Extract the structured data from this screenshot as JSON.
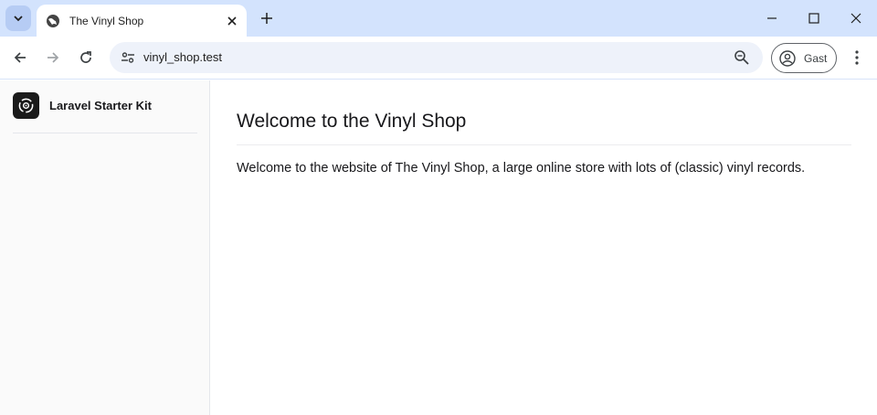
{
  "browser": {
    "tab": {
      "title": "The Vinyl Shop"
    },
    "address": {
      "url": "vinyl_shop.test"
    },
    "profile": {
      "name": "Gast"
    }
  },
  "sidebar": {
    "brand": "Laravel Starter Kit"
  },
  "main": {
    "heading": "Welcome to the Vinyl Shop",
    "text": "Welcome to the website of The Vinyl Shop, a large online store with lots of (classic) vinyl records."
  },
  "icons": [
    "chevron-down-icon",
    "globe-icon",
    "close-icon",
    "plus-icon",
    "minimize-icon",
    "maximize-icon",
    "close-window-icon",
    "back-icon",
    "forward-icon",
    "reload-icon",
    "site-settings-icon",
    "zoom-icon",
    "profile-icon",
    "more-menu-icon",
    "vinyl-logo-icon"
  ],
  "colors": {
    "titlebar": "#d3e3fd",
    "omnibox": "#eef2fa",
    "sidebar": "#fafafa",
    "logo": "#1a1a1a"
  }
}
